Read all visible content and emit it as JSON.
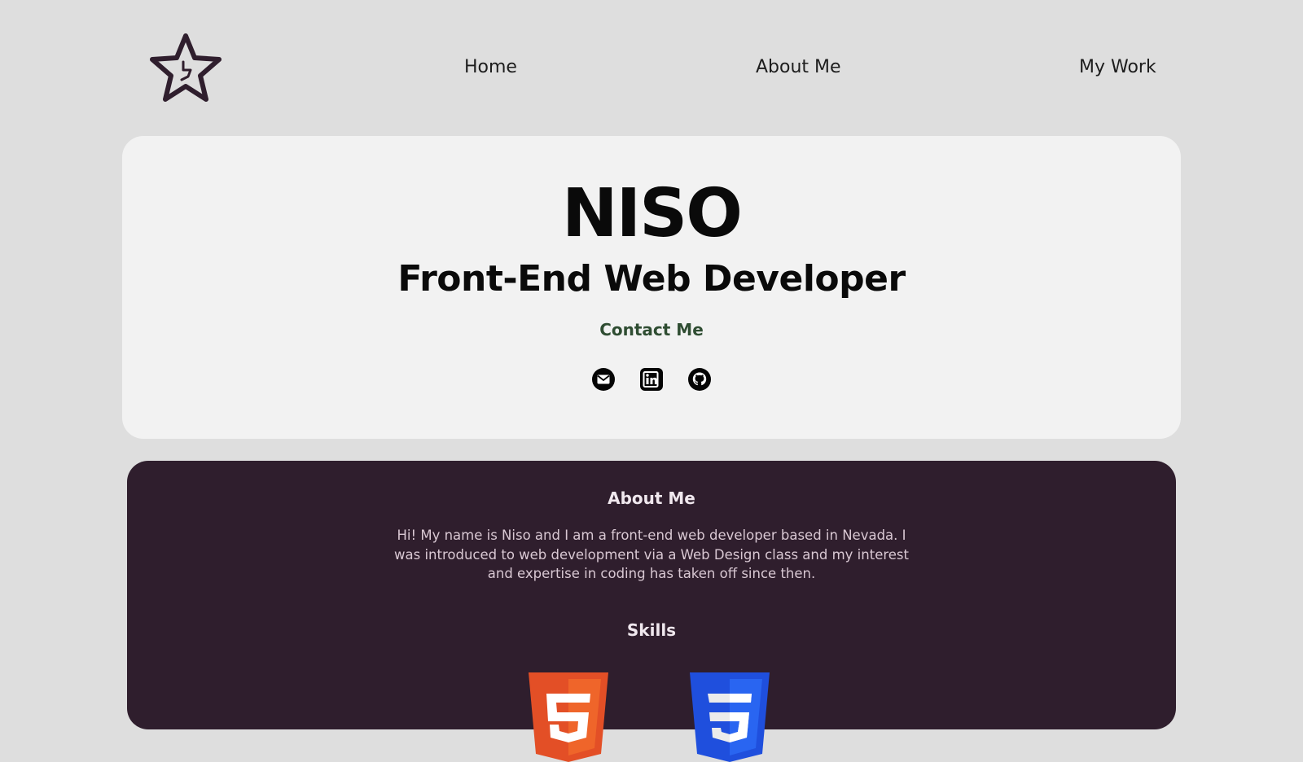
{
  "nav": {
    "logo_icon": "star-logo-icon",
    "links": [
      {
        "label": "Home"
      },
      {
        "label": "About Me"
      },
      {
        "label": "My Work"
      }
    ]
  },
  "hero": {
    "name": "NISO",
    "role": "Front-End Web Developer",
    "contact_label": "Contact Me",
    "socials": [
      {
        "icon": "email-icon"
      },
      {
        "icon": "linkedin-icon"
      },
      {
        "icon": "github-icon"
      }
    ]
  },
  "about": {
    "heading": "About Me",
    "text": "Hi! My name is Niso and I am a front-end web developer based in Nevada. I was introduced to web development via a Web Design class and my interest and expertise in coding has taken off since then.",
    "skills_heading": "Skills",
    "skills": [
      {
        "icon": "html5-icon"
      },
      {
        "icon": "css3-icon"
      }
    ]
  },
  "colors": {
    "page_bg": "#dedede",
    "card_bg": "#f2f2f2",
    "section_bg": "#2f1e2d",
    "contact_green": "#2f4d32",
    "logo_stroke": "#2f1e2d"
  }
}
